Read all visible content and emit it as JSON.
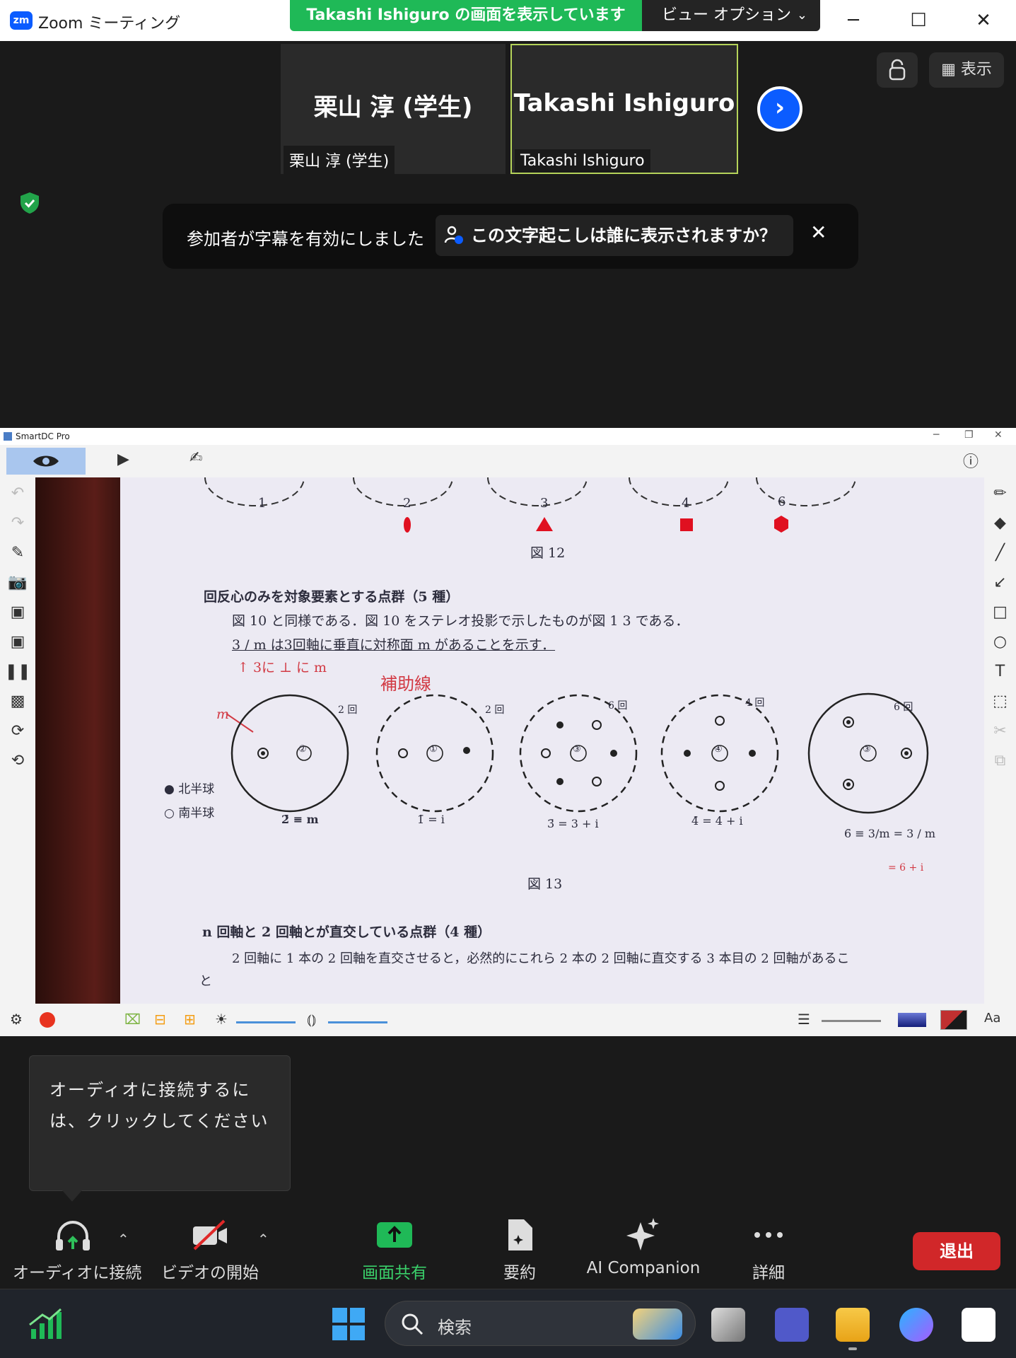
{
  "zoom": {
    "app_title": "Zoom ミーティング",
    "logo_text": "zm",
    "share_banner": "Takashi  Ishiguro の画面を表示しています",
    "view_options": "ビュー オプション",
    "window_controls": {
      "minimize": "─",
      "maximize": "☐",
      "close": "✕"
    },
    "top_right": {
      "view_label": "表示"
    }
  },
  "gallery": {
    "participants": [
      {
        "display_name": "栗山 淳 (学生)",
        "label": "栗山 淳 (学生)"
      },
      {
        "display_name": "Takashi Ishiguro",
        "label": "Takashi Ishiguro"
      }
    ],
    "next_icon": "chevron-right-icon"
  },
  "caption_notice": {
    "message": "参加者が字幕を有効にしました",
    "question": "この文字起こしは誰に表示されますか？",
    "close": "✕"
  },
  "smartdc": {
    "window_title": "SmartDC Pro",
    "document": {
      "fig_numbers": [
        "1",
        "2",
        "3",
        "4",
        "6"
      ],
      "fig12_caption": "図 12",
      "section1_heading": "回反心のみを対象要素とする点群（5 種）",
      "section1_line1": "図 10 と同様である．図 10 をステレオ投影で示したものが図 1 3 である．",
      "section1_line2": "3 / m  は3回軸に垂直に対称面 m があることを示す．",
      "annot_arrow": "↑ 3に ⊥ に m",
      "annot_hojo": "補助線",
      "annot_m": "m",
      "legend_north": "● 北半球",
      "legend_south": "○ 南半球",
      "circles": [
        {
          "center": "②",
          "top_label": "2 回",
          "bottom": "2̄ ≡ m"
        },
        {
          "center": "①",
          "top_label": "2 回",
          "bottom": "1̄ = i"
        },
        {
          "center": "③",
          "top_label": "6 回",
          "bottom": "3̄ = 3 + i"
        },
        {
          "center": "④",
          "top_label": "4 回",
          "bottom": "4̄ = 4 + i"
        },
        {
          "center": "③",
          "top_label": "6 回",
          "bottom": "6̄ ≡ 3/m = 3 / m"
        }
      ],
      "extra_eq": "= 6 + i",
      "fig13_caption": "図 13",
      "section2_heading": "n 回軸と 2 回軸とが直交している点群（4 種）",
      "section2_line1": "2 回軸に 1 本の 2 回軸を直交させると，必然的にこれら 2 本の 2 回軸に直交する 3 本目の 2 回軸があるこ",
      "section2_line2": "と"
    },
    "bottom_right_label": "Aa"
  },
  "tooltip": {
    "text": "オーディオに接続するには、クリックしてください"
  },
  "controls": {
    "audio": "オーディオに接続",
    "video": "ビデオの開始",
    "share": "画面共有",
    "summary": "要約",
    "ai": "AI Companion",
    "more": "詳細",
    "leave": "退出"
  },
  "taskbar": {
    "search_placeholder": "検索"
  },
  "colors": {
    "zoom_blue": "#0b5cff",
    "share_green": "#1fb957",
    "leave_red": "#d12729",
    "annotation_red": "#d23a44"
  }
}
